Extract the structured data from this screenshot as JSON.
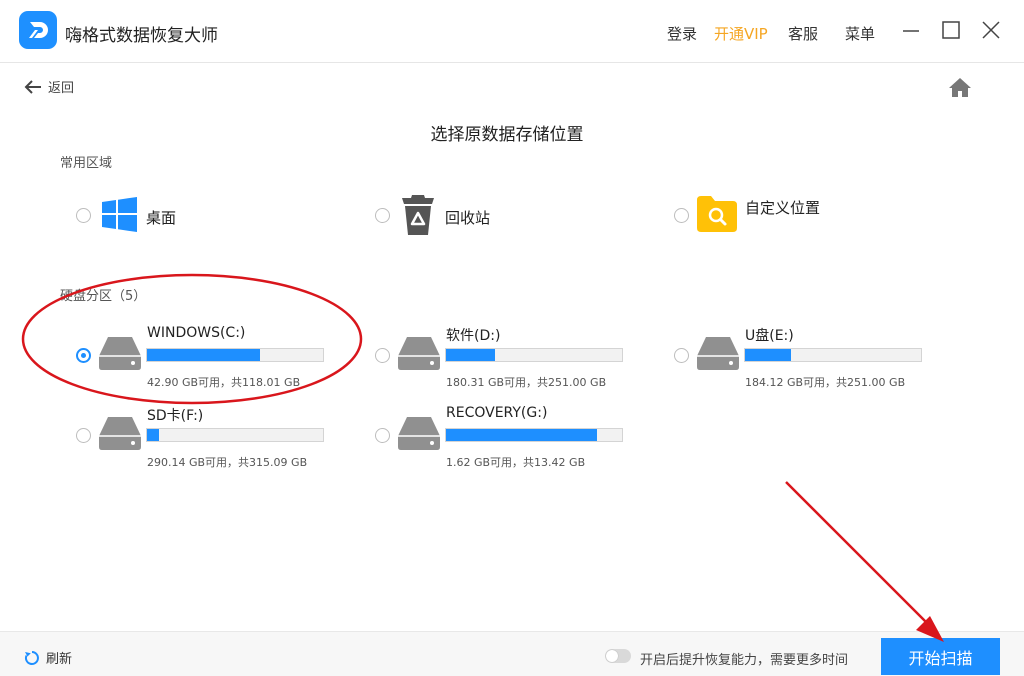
{
  "app": {
    "title": "嗨格式数据恢复大师"
  },
  "header": {
    "login": "登录",
    "vip": "开通VIP",
    "support": "客服",
    "menu": "菜单"
  },
  "nav": {
    "back_label": "返回"
  },
  "page_title": "选择原数据存储位置",
  "common_areas": {
    "label": "常用区域",
    "items": [
      {
        "label": "桌面",
        "icon": "windows-icon"
      },
      {
        "label": "回收站",
        "icon": "recycle-bin-icon"
      },
      {
        "label": "自定义位置",
        "icon": "custom-folder-icon"
      }
    ]
  },
  "partitions": {
    "label": "硬盘分区（5）",
    "drives": [
      {
        "name": "WINDOWS(C:)",
        "info": "42.90 GB可用，共118.01 GB",
        "used_fraction": 0.64,
        "selected": true
      },
      {
        "name": "软件(D:)",
        "info": "180.31 GB可用，共251.00 GB",
        "used_fraction": 0.28,
        "selected": false
      },
      {
        "name": "U盘(E:)",
        "info": "184.12 GB可用，共251.00 GB",
        "used_fraction": 0.26,
        "selected": false
      },
      {
        "name": "SD卡(F:)",
        "info": "290.14 GB可用，共315.09 GB",
        "used_fraction": 0.07,
        "selected": false
      },
      {
        "name": "RECOVERY(G:)",
        "info": "1.62 GB可用，共13.42 GB",
        "used_fraction": 0.86,
        "selected": false
      }
    ]
  },
  "footer": {
    "refresh_label": "刷新",
    "toggle_label": "开启后提升恢复能力，需要更多时间",
    "toggle_on": false,
    "scan_button": "开始扫描"
  },
  "colors": {
    "accent": "#1e8fff",
    "vip": "#f5a623",
    "annotation": "#d9161c"
  }
}
